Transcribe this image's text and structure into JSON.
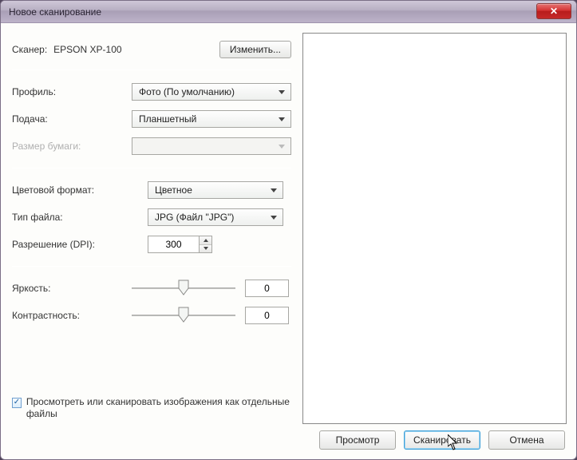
{
  "window": {
    "title": "Новое сканирование"
  },
  "scanner": {
    "label": "Сканер:",
    "name": "EPSON XP-100"
  },
  "buttons": {
    "change": "Изменить...",
    "preview": "Просмотр",
    "scan": "Сканировать",
    "cancel": "Отмена"
  },
  "fields": {
    "profile": {
      "label": "Профиль:",
      "value": "Фото (По умолчанию)"
    },
    "source": {
      "label": "Подача:",
      "value": "Планшетный"
    },
    "papersize": {
      "label": "Размер бумаги:",
      "value": ""
    },
    "colorformat": {
      "label": "Цветовой формат:",
      "value": "Цветное"
    },
    "filetype": {
      "label": "Тип файла:",
      "value": "JPG (Файл \"JPG\")"
    },
    "resolution": {
      "label": "Разрешение (DPI):",
      "value": "300"
    },
    "brightness": {
      "label": "Яркость:",
      "value": "0"
    },
    "contrast": {
      "label": "Контрастность:",
      "value": "0"
    }
  },
  "checkbox": {
    "label": "Просмотреть или сканировать изображения как отдельные файлы",
    "checked": true
  }
}
